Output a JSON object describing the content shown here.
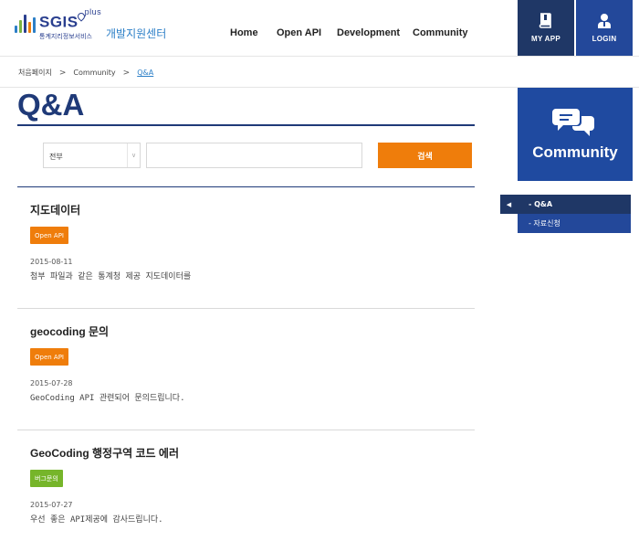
{
  "header": {
    "logo_main": "SGIS",
    "logo_sup": "plus",
    "logo_sub": "통계지리정보서비스",
    "logo_center": "개발지원센터",
    "nav": [
      "Home",
      "Open API",
      "Development",
      "Community"
    ],
    "myapp_label": "MY APP",
    "login_label": "LOGIN"
  },
  "breadcrumb": {
    "items": [
      "처음페이지",
      "Community",
      "Q&A"
    ]
  },
  "page": {
    "title": "Q&A"
  },
  "search": {
    "select_value": "전부",
    "input_value": "",
    "button_label": "검색"
  },
  "posts": [
    {
      "title": "지도데이터",
      "badge": "Open API",
      "date": "2015-08-11",
      "body": "첨부 파일과 같은 통계청 제공 지도데이터를"
    },
    {
      "title": "geocoding 문의",
      "badge": "Open API",
      "date": "2015-07-28",
      "body": "GeoCoding API 관련되어 문의드립니다."
    },
    {
      "title": "GeoCoding 행정구역 코드 에러",
      "badge": "버그문의",
      "date": "2015-07-27",
      "body": "우선 좋은 API제공에 감사드립니다."
    }
  ],
  "sidebar": {
    "title": "Community",
    "menu": [
      "- Q&A",
      "- 자료신청"
    ]
  },
  "colors": {
    "navy": "#1f3766",
    "blue": "#23489a",
    "title_blue": "#1f3a78",
    "orange": "#ef7d0b",
    "green": "#76b52a",
    "link_blue": "#2c7fc7"
  }
}
